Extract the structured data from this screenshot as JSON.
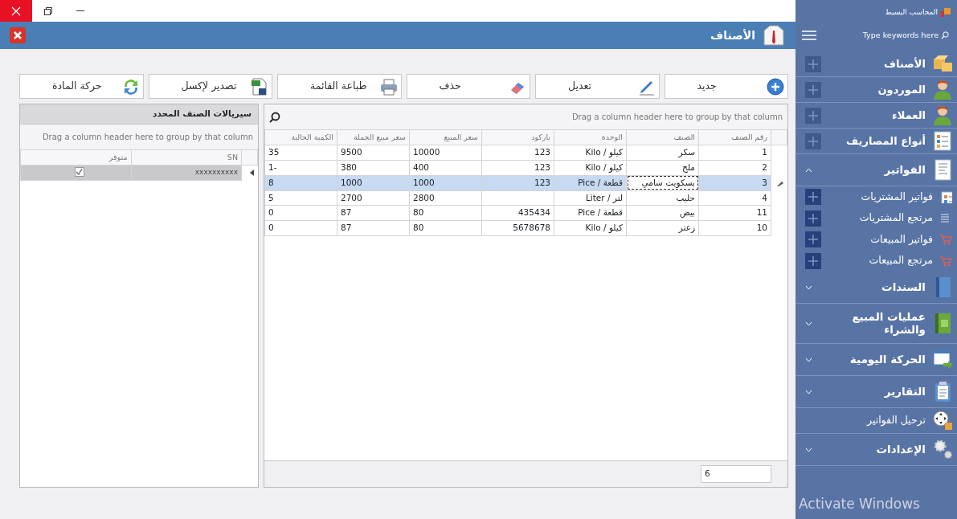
{
  "header": {
    "title": "الأصناف"
  },
  "toolbar": [
    {
      "label": "جديد",
      "kind": "new"
    },
    {
      "label": "تعديل",
      "kind": "edit"
    },
    {
      "label": "حذف",
      "kind": "delete"
    },
    {
      "label": "طباعة القائمة",
      "kind": "print"
    },
    {
      "label": "تصدير لإكسل",
      "kind": "excel"
    },
    {
      "label": "حركة المادة",
      "kind": "movement"
    }
  ],
  "items_grid": {
    "group_hint": "Drag a column header here to group by that column",
    "columns": [
      "رقم الصنف",
      "الصنف",
      "الوحدة",
      "باركود",
      "سعر المبيع",
      "سعر مبيع الجملة",
      "الكمية الحالية"
    ],
    "rows": [
      {
        "cells": [
          "1",
          "سكر",
          "كيلو / Kilo",
          "123",
          "10000",
          "9500",
          "35"
        ],
        "selected": false
      },
      {
        "cells": [
          "2",
          "ملح",
          "كيلو / Kilo",
          "123",
          "400",
          "380",
          "1-"
        ],
        "selected": false
      },
      {
        "cells": [
          "3",
          "بسكويت سامي",
          "قطعة / Pice",
          "123",
          "1000",
          "1000",
          "8"
        ],
        "selected": true
      },
      {
        "cells": [
          "4",
          "حليب",
          "لتر / Liter",
          "",
          "2800",
          "2700",
          "5"
        ],
        "selected": false
      },
      {
        "cells": [
          "11",
          "بيض",
          "قطعة / Pice",
          "435434",
          "80",
          "87",
          "0"
        ],
        "selected": false
      },
      {
        "cells": [
          "10",
          "زعتر",
          "كيلو / Kilo",
          "5678678",
          "80",
          "87",
          "0"
        ],
        "selected": false
      }
    ],
    "footer_value": "6"
  },
  "serials_panel": {
    "title": "سيريالات الصنف المحدد",
    "group_hint": "Drag a column header here to group by that column",
    "columns": [
      "SN",
      "متوفر"
    ],
    "rows": [
      {
        "sn": "xxxxxxxxxx",
        "available": true,
        "selected": true
      }
    ]
  },
  "sidebar": {
    "app_title": "المحاسب البسيط",
    "search": {
      "placeholder": "Type keywords here"
    },
    "items": [
      {
        "kind": "entry",
        "label": "الأصناف"
      },
      {
        "kind": "entry",
        "label": "الموردون"
      },
      {
        "kind": "entry",
        "label": "العملاء"
      },
      {
        "kind": "entry",
        "label": "أنواع المصاريف"
      },
      {
        "kind": "group",
        "label": "الفواتير",
        "expanded": true,
        "children": [
          {
            "label": "فواتير المشتريات"
          },
          {
            "label": "مرتجع المشتريات"
          },
          {
            "label": "فواتير المبيعات"
          },
          {
            "label": "مرتجع المبيعات"
          }
        ]
      },
      {
        "kind": "group",
        "label": "السندات",
        "expanded": false
      },
      {
        "kind": "group",
        "label": "عمليات المبيع والشراء",
        "expanded": false
      },
      {
        "kind": "group",
        "label": "الحركة اليومية",
        "expanded": false
      },
      {
        "kind": "group",
        "label": "التقارير",
        "expanded": false
      },
      {
        "kind": "link",
        "label": "ترحيل الفواتير"
      },
      {
        "kind": "group",
        "label": "الإعدادات",
        "expanded": false
      }
    ]
  },
  "os_notice": "Activate Windows"
}
